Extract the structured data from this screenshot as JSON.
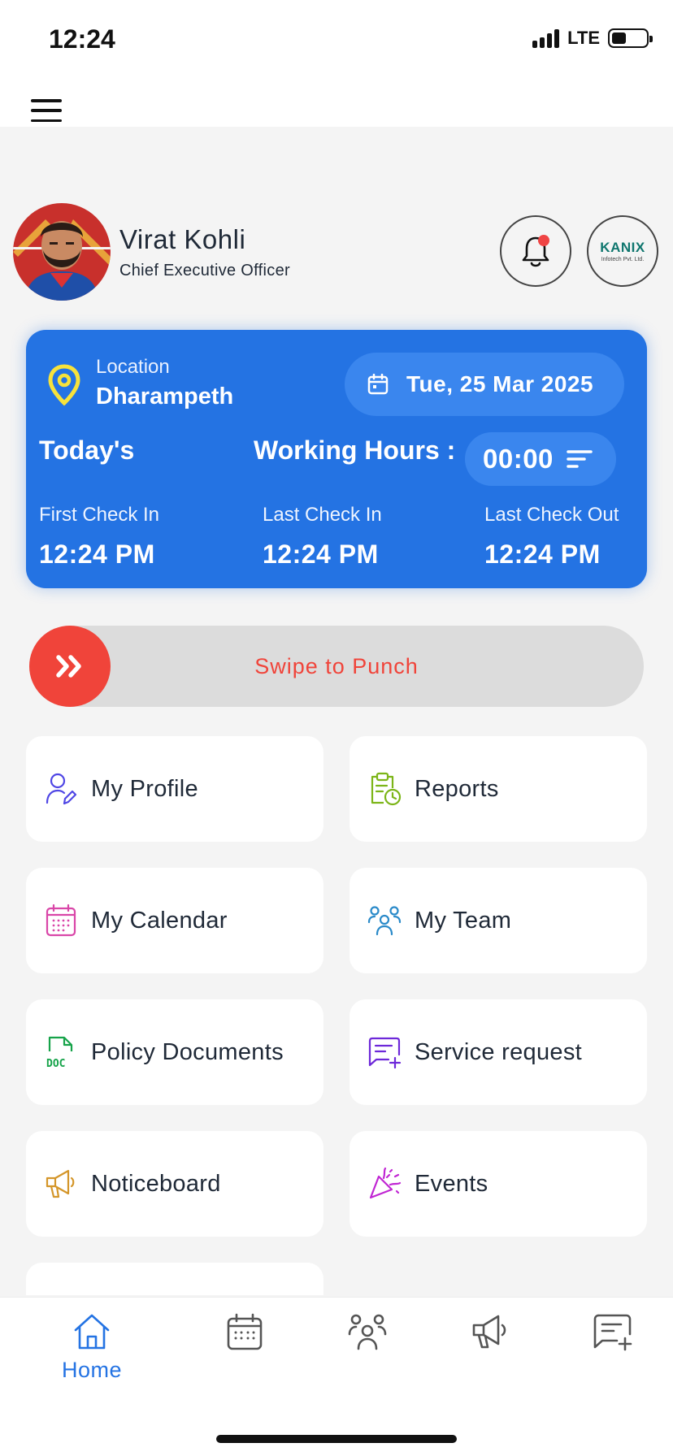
{
  "status_bar": {
    "time": "12:24",
    "network": "LTE",
    "icons": [
      "signal-icon",
      "battery-icon"
    ]
  },
  "app_bar": {
    "menu_icon": "hamburger-menu-icon"
  },
  "profile": {
    "name": "Virat  Kohli",
    "role": "Chief Executive Officer",
    "notification_icon": "bell-icon",
    "company_logo_text": "KANIX",
    "company_logo_sub": "Infotech Pvt. Ltd."
  },
  "attendance": {
    "location_label": "Location",
    "location_value": "Dharampeth",
    "date": "Tue, 25 Mar 2025",
    "todays_label": "Today's",
    "working_hours_label": "Working Hours :",
    "working_hours_value": "00:00",
    "first_check_in_label": "First Check In",
    "first_check_in_value": "12:24 PM",
    "last_check_in_label": "Last Check In",
    "last_check_in_value": "12:24 PM",
    "last_check_out_label": "Last Check Out",
    "last_check_out_value": "12:24 PM"
  },
  "swipe": {
    "label": "Swipe to  Punch",
    "icon": "double-chevron-right-icon"
  },
  "tiles": [
    {
      "label": "My Profile",
      "icon": "user-edit-icon"
    },
    {
      "label": "Reports",
      "icon": "clipboard-clock-icon"
    },
    {
      "label": "My Calendar",
      "icon": "calendar-icon"
    },
    {
      "label": "My Team",
      "icon": "team-icon"
    },
    {
      "label": "Policy Documents",
      "icon": "doc-file-icon"
    },
    {
      "label": "Service request",
      "icon": "message-plus-icon"
    },
    {
      "label": "Noticeboard",
      "icon": "megaphone-icon"
    },
    {
      "label": "Events",
      "icon": "party-popper-icon"
    }
  ],
  "bottom_nav": {
    "home_label": "Home",
    "items": [
      "home-icon",
      "calendar-icon",
      "team-icon",
      "megaphone-icon",
      "message-plus-icon"
    ]
  },
  "colors": {
    "primary_blue": "#2473e3",
    "accent_red": "#f0443a",
    "background": "#f4f4f4"
  }
}
